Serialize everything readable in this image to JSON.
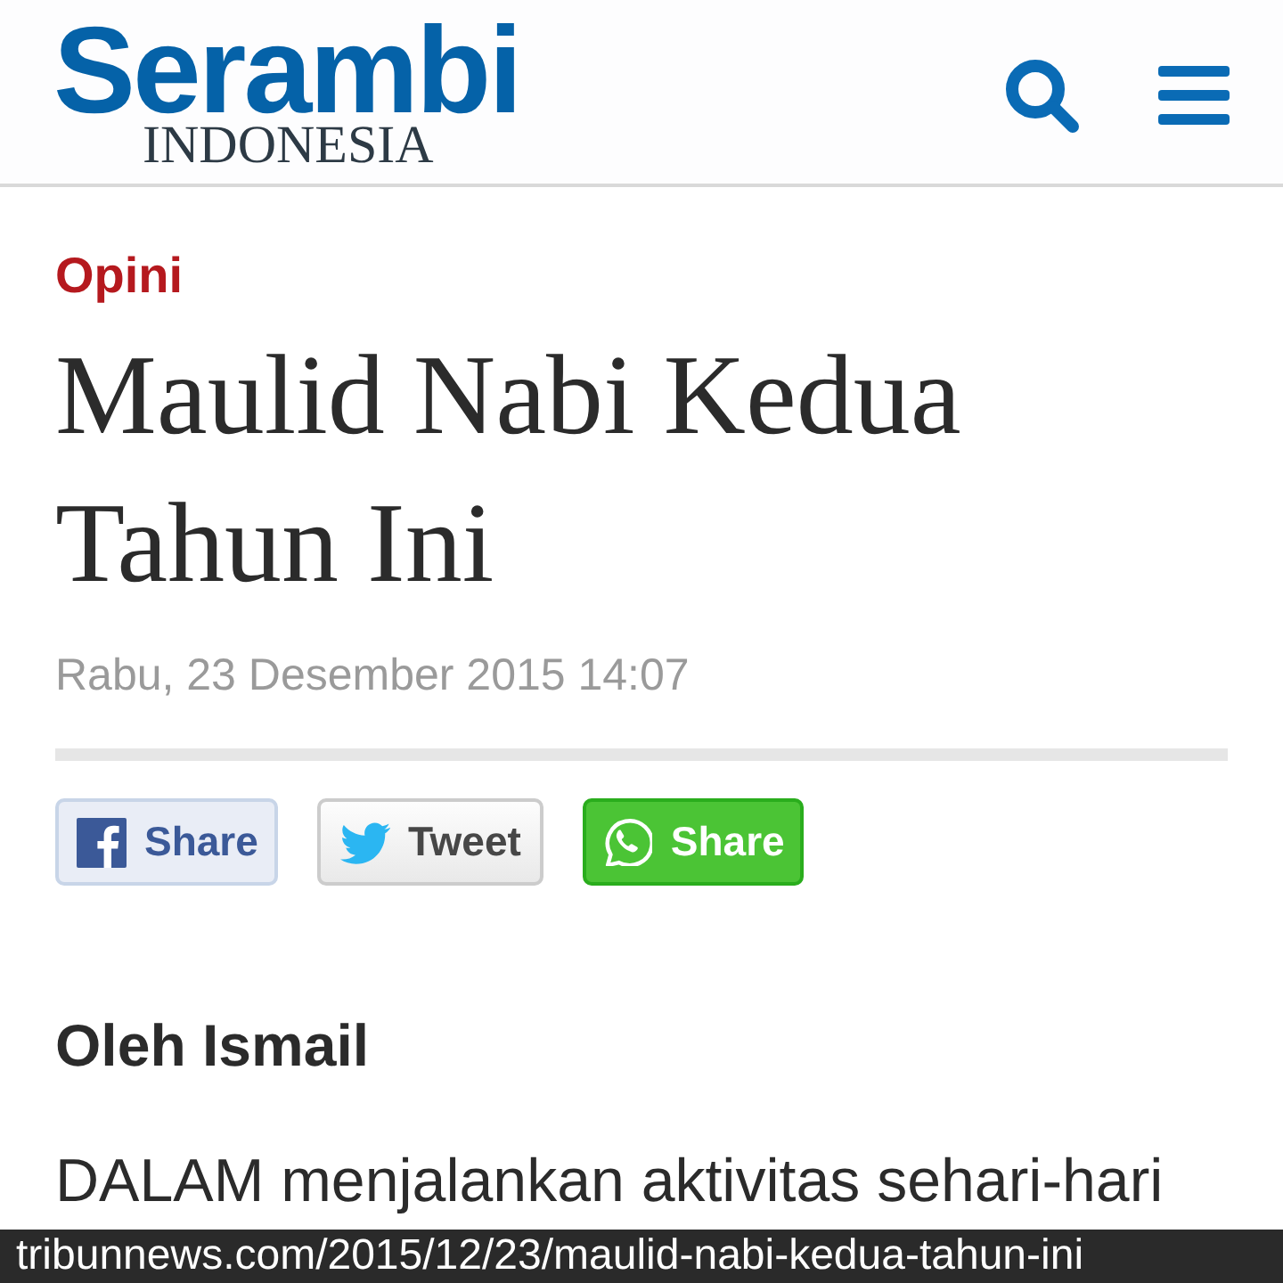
{
  "header": {
    "logo": {
      "name": "Serambi",
      "tagline": "INDONESIA"
    }
  },
  "article": {
    "category": "Opini",
    "title": "Maulid Nabi Kedua Tahun Ini",
    "date": "Rabu, 23 Desember 2015 14:07",
    "share_buttons": [
      {
        "kind": "facebook",
        "label": "Share"
      },
      {
        "kind": "twitter",
        "label": "Tweet"
      },
      {
        "kind": "whatsapp",
        "label": "Share"
      }
    ],
    "author": "Oleh Ismail",
    "body": "DALAM menjalankan aktivitas sehari-hari"
  },
  "status_bar": {
    "url": "tribunnews.com/2015/12/23/maulid-nabi-kedua-tahun-ini"
  }
}
